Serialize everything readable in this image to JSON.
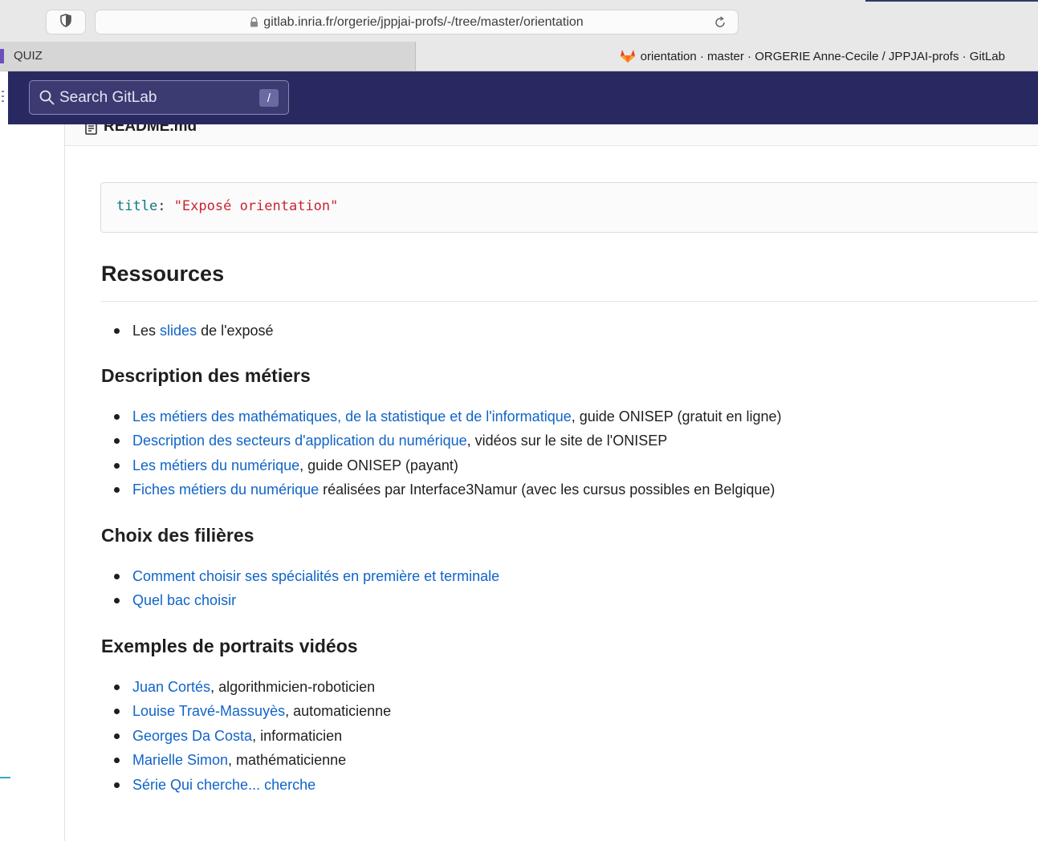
{
  "browser": {
    "url": "gitlab.inria.fr/orgerie/jppjai-profs/-/tree/master/orientation",
    "tabs": [
      {
        "label": "QUIZ",
        "active": false
      },
      {
        "label": "orientation · master · ORGERIE Anne-Cecile / JPPJAI-profs · GitLab",
        "active": true,
        "icon": "gitlab-fox-icon"
      }
    ],
    "icons": [
      "shield-icon",
      "lock-icon",
      "reload-icon"
    ]
  },
  "gitlab": {
    "header_color": "#292961",
    "search": {
      "placeholder": "Search GitLab",
      "shortcut": "/"
    }
  },
  "file": {
    "name": "README.md",
    "front_matter": {
      "key": "title",
      "colon": ":",
      "value": "\"Exposé orientation\""
    }
  },
  "readme": {
    "heading": "Ressources",
    "resources": [
      {
        "before": "Les ",
        "link": "slides",
        "after": " de l'exposé"
      }
    ],
    "sections": {
      "metiers": {
        "title": "Description des métiers",
        "items": [
          {
            "link": "Les métiers des mathématiques, de la statistique et de l'informatique",
            "after": ", guide ONISEP (gratuit en ligne)"
          },
          {
            "link": "Description des secteurs d'application du numérique",
            "after": ", vidéos sur le site de l'ONISEP"
          },
          {
            "link": "Les métiers du numérique",
            "after": ", guide ONISEP (payant)"
          },
          {
            "link": "Fiches métiers du numérique",
            "after": " réalisées par Interface3Namur (avec les cursus possibles en Belgique)"
          }
        ]
      },
      "choix": {
        "title": "Choix des filières",
        "items": [
          {
            "link": "Comment choisir ses spécialités en première et terminale",
            "after": ""
          },
          {
            "link": "Quel bac choisir",
            "after": ""
          }
        ]
      },
      "portraits": {
        "title": "Exemples de portraits vidéos",
        "items": [
          {
            "link": "Juan Cortés",
            "after": ", algorithmicien-roboticien"
          },
          {
            "link": "Louise Travé-Massuyès",
            "after": ", automaticienne"
          },
          {
            "link": "Georges Da Costa",
            "after": ", informaticien"
          },
          {
            "link": "Marielle Simon",
            "after": ", mathématicienne"
          },
          {
            "link": "Série Qui cherche... cherche",
            "after": ""
          }
        ]
      }
    }
  }
}
